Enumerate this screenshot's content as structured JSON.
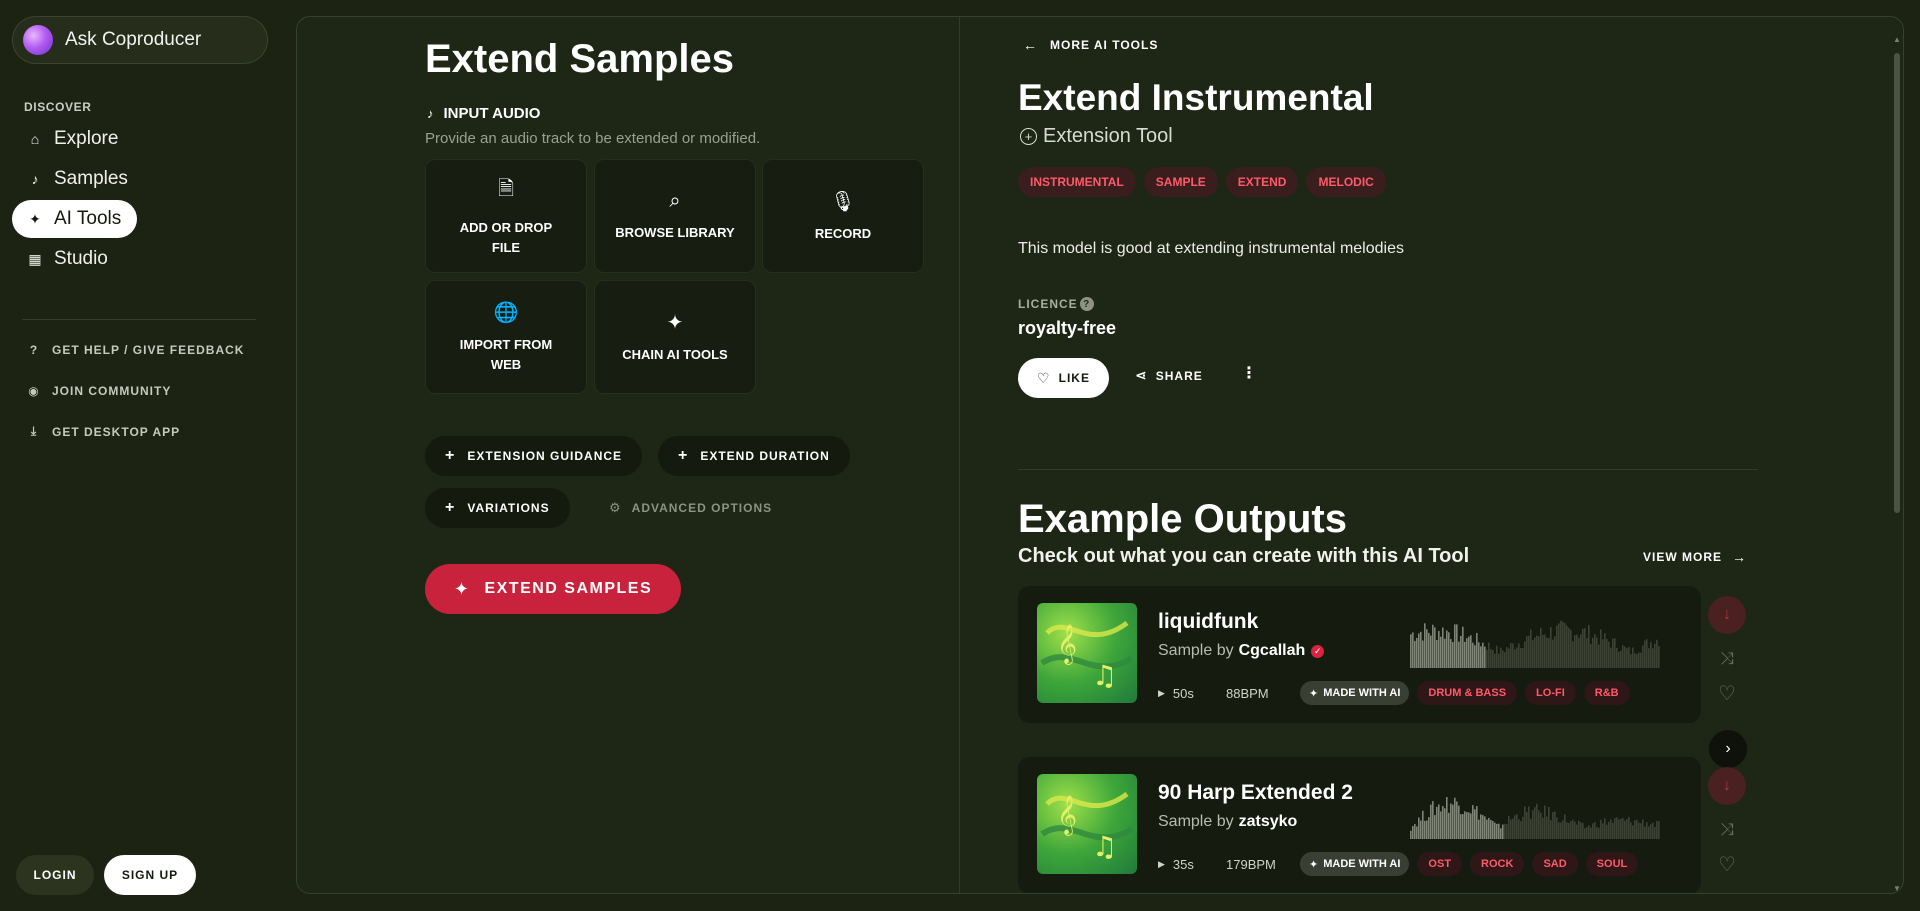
{
  "sidebar": {
    "ask_label": "Ask Coproducer",
    "discover_label": "DISCOVER",
    "nav": [
      {
        "label": "Explore",
        "icon": "home-icon"
      },
      {
        "label": "Samples",
        "icon": "music-note-icon"
      },
      {
        "label": "AI Tools",
        "icon": "sparkles-icon",
        "active": true
      },
      {
        "label": "Studio",
        "icon": "grid-icon"
      }
    ],
    "links": [
      {
        "label": "GET HELP / GIVE FEEDBACK",
        "icon": "help-circle-icon"
      },
      {
        "label": "JOIN COMMUNITY",
        "icon": "discord-icon"
      },
      {
        "label": "GET DESKTOP APP",
        "icon": "download-icon"
      }
    ],
    "login_label": "LOGIN",
    "signup_label": "SIGN UP"
  },
  "left": {
    "title": "Extend Samples",
    "input_audio_label": "INPUT AUDIO",
    "input_audio_sub": "Provide an audio track to be extended or modified.",
    "tiles": [
      {
        "label": "ADD OR DROP FILE",
        "icon": "file-audio-icon"
      },
      {
        "label": "BROWSE LIBRARY",
        "icon": "search-icon"
      },
      {
        "label": "RECORD",
        "icon": "microphone-icon"
      },
      {
        "label": "IMPORT FROM WEB",
        "icon": "globe-icon"
      },
      {
        "label": "CHAIN AI TOOLS",
        "icon": "sparkles-icon"
      }
    ],
    "options": {
      "guidance": "EXTENSION GUIDANCE",
      "duration": "EXTEND DURATION",
      "variations": "VARIATIONS",
      "advanced": "ADVANCED OPTIONS"
    },
    "submit_label": "EXTEND SAMPLES"
  },
  "right": {
    "more_tools": "MORE AI TOOLS",
    "tool_name": "Extend Instrumental",
    "tool_type": "Extension Tool",
    "tags": [
      "INSTRUMENTAL",
      "SAMPLE",
      "EXTEND",
      "MELODIC"
    ],
    "description": "This model is good at extending instrumental melodies",
    "licence_label": "LICENCE",
    "licence_value": "royalty-free",
    "like_label": "LIKE",
    "share_label": "SHARE",
    "examples_title": "Example Outputs",
    "examples_sub": "Check out what you can create with this AI Tool",
    "view_more": "VIEW MORE",
    "samples": [
      {
        "title": "liquidfunk",
        "by_label": "Sample by",
        "author": "Cgcallah",
        "verified": true,
        "duration": "50s",
        "bpm": "88BPM",
        "ai_badge": "MADE WITH AI",
        "genres": [
          "DRUM & BASS",
          "LO-FI",
          "R&B"
        ],
        "progress": 0.3
      },
      {
        "title": "90 Harp Extended 2",
        "by_label": "Sample by",
        "author": "zatsyko",
        "verified": false,
        "duration": "35s",
        "bpm": "179BPM",
        "ai_badge": "MADE WITH AI",
        "genres": [
          "OST",
          "ROCK",
          "SAD",
          "SOUL"
        ],
        "progress": 0.37
      }
    ]
  },
  "colors": {
    "background": "#1c2313",
    "panel": "#1e2615",
    "accent_red": "#c8223c",
    "tag_text": "#ff5a6a",
    "tag_bg": "#3a1d1d"
  }
}
